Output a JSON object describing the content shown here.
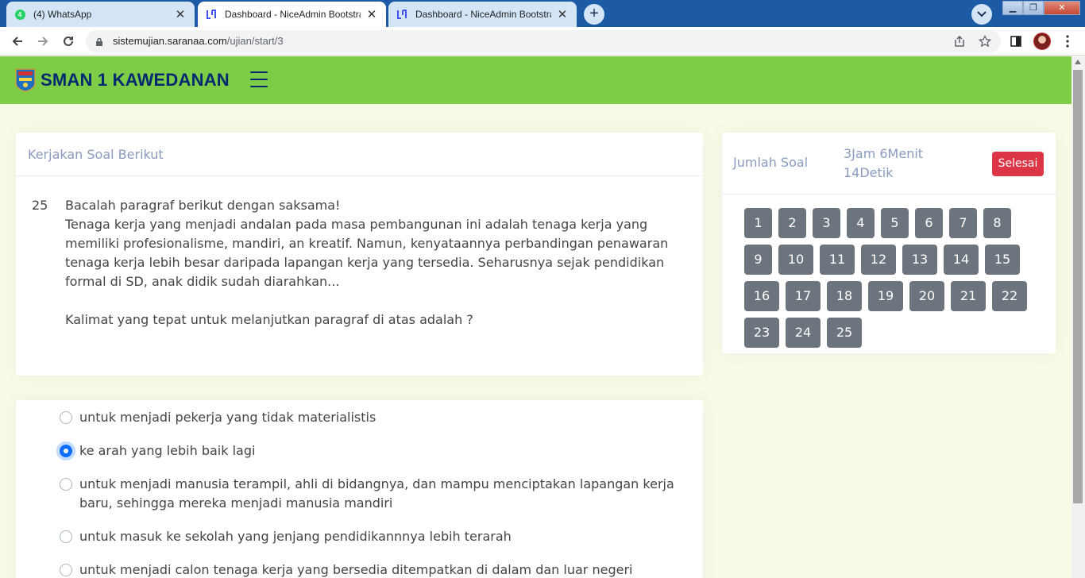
{
  "browser": {
    "tabs": [
      {
        "title": "(4) WhatsApp",
        "badge": "4"
      },
      {
        "title": "Dashboard - NiceAdmin Bootstrap"
      },
      {
        "title": "Dashboard - NiceAdmin Bootstrap"
      }
    ],
    "url_host": "sistemujian.saranaa.com",
    "url_path": "/ujian/start/3"
  },
  "header": {
    "brand": "SMAN 1 KAWEDANAN"
  },
  "question": {
    "card_title": "Kerjakan Soal Berikut",
    "number": "25",
    "instruction": "Bacalah paragraf berikut dengan saksama!",
    "paragraph": "Tenaga kerja yang menjadi andalan pada masa pembangunan ini adalah tenaga kerja yang memiliki profesionalisme, mandiri, an kreatif. Namun, kenyataannya perbandingan penawaran tenaga kerja lebih besar daripada lapangan kerja yang tersedia. Seharusnya sejak pendidikan formal di SD, anak didik sudah diarahkan...",
    "prompt": "Kalimat yang tepat untuk melanjutkan paragraf di atas adalah ?"
  },
  "answers": [
    {
      "label": "untuk menjadi pekerja yang tidak materialistis",
      "selected": false
    },
    {
      "label": "ke arah yang lebih baik lagi",
      "selected": true
    },
    {
      "label": "untuk menjadi manusia terampil, ahli di bidangnya, dan mampu menciptakan lapangan kerja baru, sehingga mereka menjadi manusia mandiri",
      "selected": false
    },
    {
      "label": "untuk masuk ke sekolah yang jenjang pendidikannnya lebih terarah",
      "selected": false
    },
    {
      "label": "untuk menjadi calon tenaga kerja yang bersedia ditempatkan di dalam dan luar negeri",
      "selected": false
    }
  ],
  "sidebar": {
    "title": "Jumlah Soal",
    "timer_line1": "3Jam 6Menit",
    "timer_line2": "14Detik",
    "finish_label": "Selesai",
    "questions": [
      "1",
      "2",
      "3",
      "4",
      "5",
      "6",
      "7",
      "8",
      "9",
      "10",
      "11",
      "12",
      "13",
      "14",
      "15",
      "16",
      "17",
      "18",
      "19",
      "20",
      "21",
      "22",
      "23",
      "24",
      "25"
    ]
  },
  "colors": {
    "header_green": "#7ecd47",
    "brand_navy": "#012970",
    "danger": "#dc3545",
    "question_button": "#6c757d",
    "radio_checked": "#0d6efd"
  }
}
